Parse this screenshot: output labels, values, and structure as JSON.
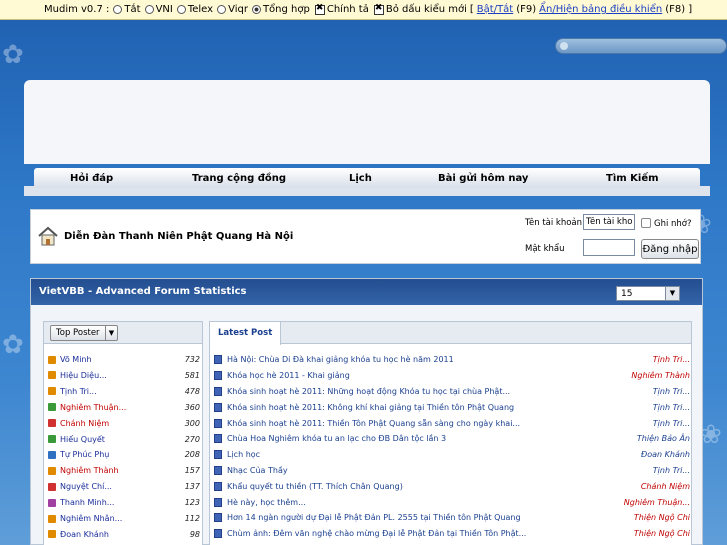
{
  "mudim": {
    "label": "Mudim v0.7 :",
    "opts": [
      "Tắt",
      "VNI",
      "Telex",
      "Viqr",
      "Tổng hợp"
    ],
    "selected": "Tổng hợp",
    "check1": "Chính tả",
    "check2": "Bỏ dấu kiểu mới",
    "bracket_open": "[",
    "link1": "Bật/Tắt",
    "key1": "(F9)",
    "link2": "Ẩn/Hiện bảng điều khiển",
    "key2": "(F8) ]"
  },
  "nav": {
    "items": [
      "Hỏi đáp",
      "Trang cộng đồng",
      "Lịch",
      "Bài gửi hôm nay",
      "Tìm Kiếm"
    ]
  },
  "header": {
    "title": "Diễn Đàn Thanh Niên Phật Quang Hà Nội",
    "user_label": "Tên tài khoản",
    "user_value": "Tên tài khoản",
    "remember": "Ghi nhớ?",
    "pass_label": "Mật khẩu",
    "login": "Đăng nhập"
  },
  "stats": {
    "title": "VietVBB - Advanced Forum Statistics",
    "count": "15",
    "top_poster": "Top Poster",
    "latest_tab": "Latest Post"
  },
  "posters": [
    {
      "name": "Võ Minh",
      "count": "732",
      "color": "#e08a00",
      "red": false
    },
    {
      "name": "Hiệu Diệu...",
      "count": "581",
      "color": "#e08a00",
      "red": false
    },
    {
      "name": "Tịnh Tri...",
      "count": "478",
      "color": "#e08a00",
      "red": false
    },
    {
      "name": "Nghiêm Thuận...",
      "count": "360",
      "color": "#3a9a3a",
      "red": true
    },
    {
      "name": "Chánh Niệm",
      "count": "300",
      "color": "#d03030",
      "red": true
    },
    {
      "name": "Hiếu Quyết",
      "count": "270",
      "color": "#3a9a3a",
      "red": false
    },
    {
      "name": "Tự Phúc Phụ",
      "count": "208",
      "color": "#3070c0",
      "red": false
    },
    {
      "name": "Nghiêm Thành",
      "count": "157",
      "color": "#e08a00",
      "red": true
    },
    {
      "name": "Nguyệt Chí...",
      "count": "137",
      "color": "#d03030",
      "red": false
    },
    {
      "name": "Thanh Minh...",
      "count": "123",
      "color": "#a040a0",
      "red": false
    },
    {
      "name": "Nghiêm Nhân...",
      "count": "112",
      "color": "#e08a00",
      "red": false
    },
    {
      "name": "Đoan Khánh",
      "count": "98",
      "color": "#e08a00",
      "red": false
    }
  ],
  "posts": [
    {
      "title": "Hà Nội: Chùa Di Đà khai giảng khóa tu học hè năm 2011",
      "author": "Tịnh Tri...",
      "red": true
    },
    {
      "title": "Khóa học hè 2011 - Khai giảng",
      "author": "Nghiêm Thành",
      "red": true
    },
    {
      "title": "Khóa sinh hoạt hè 2011: Những hoạt động Khóa tu học tại chùa Phật...",
      "author": "Tịnh Tri...",
      "red": false
    },
    {
      "title": "Khóa sinh hoạt hè 2011: Không khí khai giảng tại Thiền tôn Phật Quang",
      "author": "Tịnh Tri...",
      "red": false
    },
    {
      "title": "Khóa sinh hoạt hè 2011: Thiền Tôn Phật Quang sẵn sàng cho ngày khai...",
      "author": "Tịnh Tri...",
      "red": false
    },
    {
      "title": "Chùa Hoa Nghiêm khóa tu an lạc cho ĐB Dân tộc lần 3",
      "author": "Thiện Bảo Ân",
      "red": false
    },
    {
      "title": "Lịch học",
      "author": "Đoan Khánh",
      "red": false
    },
    {
      "title": "Nhạc Của Thầy",
      "author": "Tịnh Tri...",
      "red": false
    },
    {
      "title": "Khẩu quyết tu thiền (TT. Thích Chân Quang)",
      "author": "Chánh Niệm",
      "red": true
    },
    {
      "title": "Hè này, học thêm...",
      "author": "Nghiêm Thuận...",
      "red": true
    },
    {
      "title": "Hơn 14 ngàn người dự Đại lễ Phật Đản PL. 2555 tại Thiền tôn Phật Quang",
      "author": "Thiện Ngộ Chi",
      "red": true
    },
    {
      "title": "Chùm ảnh: Đêm văn nghệ chào mừng Đại lễ Phật Đản tại Thiền Tôn Phật...",
      "author": "Thiện Ngộ Chi",
      "red": true
    }
  ]
}
